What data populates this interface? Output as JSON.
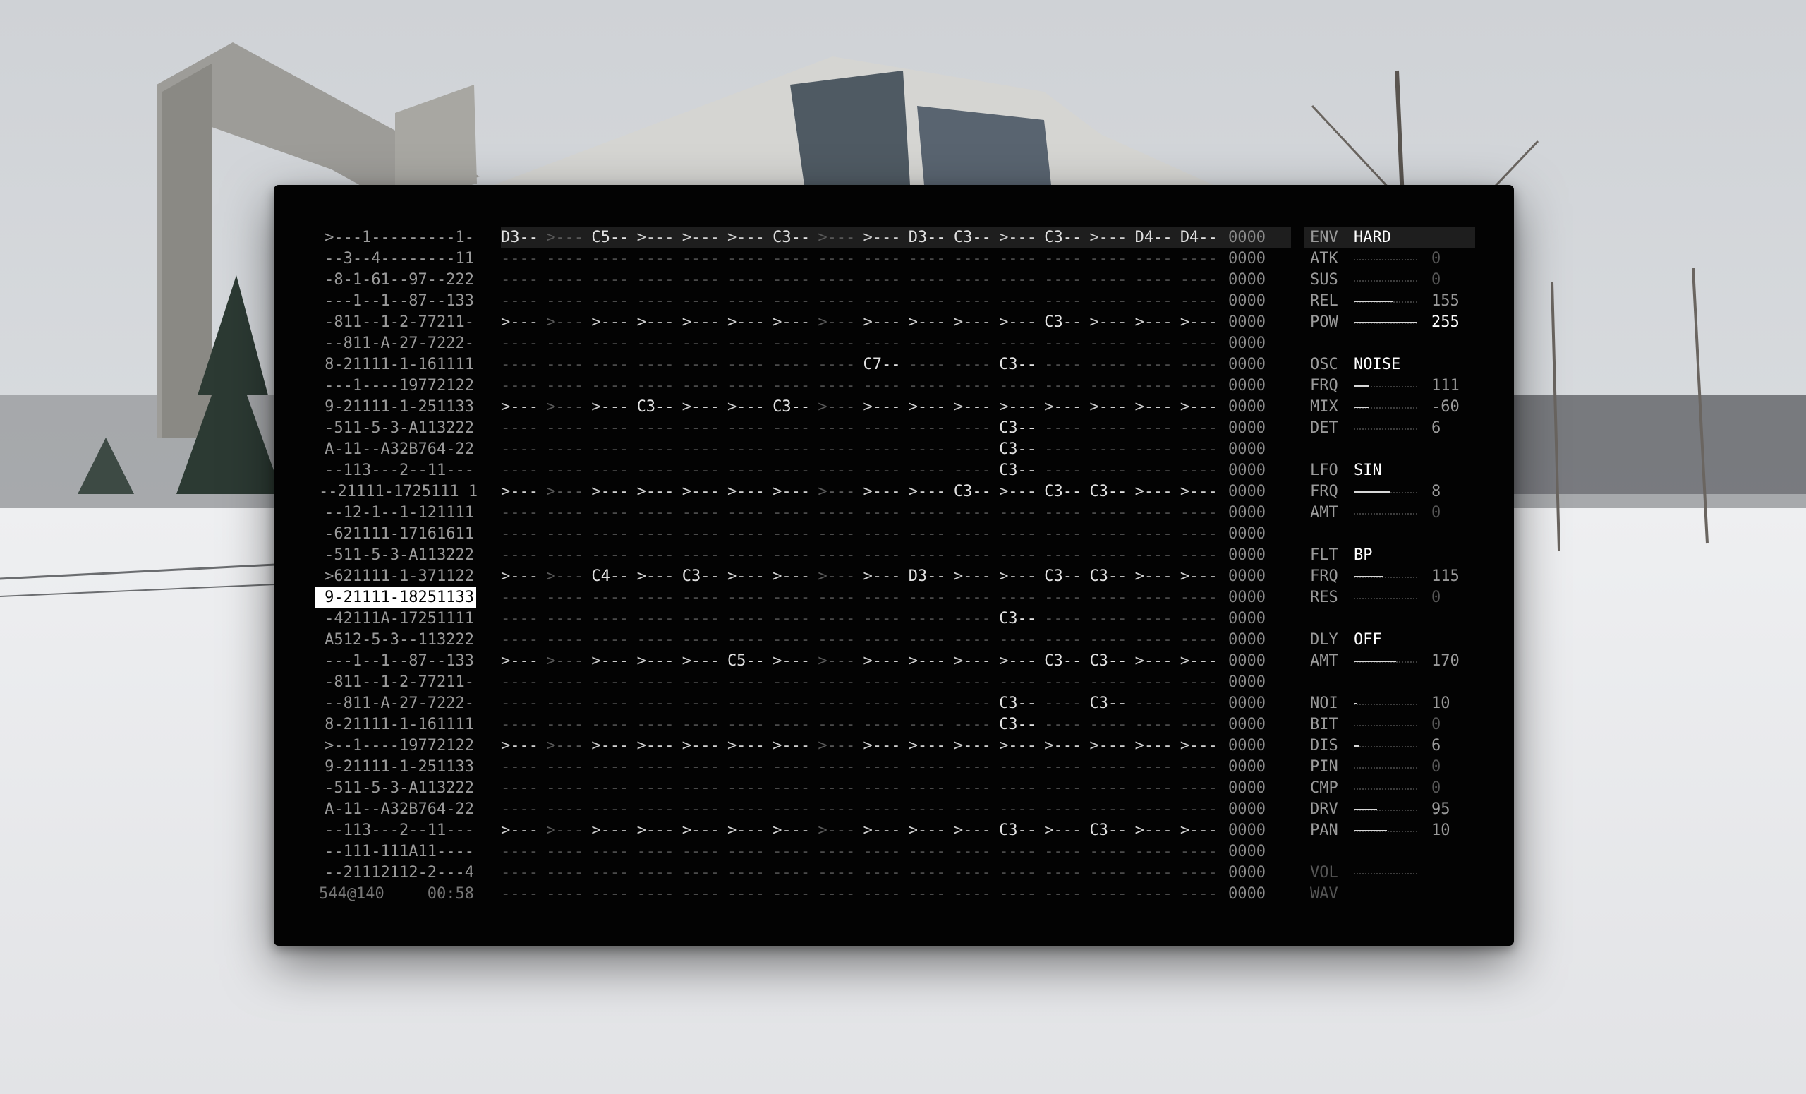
{
  "sequence": {
    "rows": [
      ">---1---------1-",
      "--3--4--------11",
      "-8-1-61--97--222",
      "---1--1--87--133",
      "-811--1-2-77211-",
      "--811-A-27-7222-",
      "8-21111-1-161111",
      "---1----19772122",
      "9-21111-1-251133",
      "-511-5-3-A113222",
      "A-11--A32B764-22",
      "--113---2--11---",
      "--21111-1725111 1",
      "--12-1--1-121111",
      "-621111-17161611",
      "-511-5-3-A113222",
      ">621111-1-371122",
      "9-21111-18251133",
      "-42111A-17251111",
      "A512-5-3--113222",
      "---1--1--87--133",
      "-811--1-2-77211-",
      "--811-A-27-7222-",
      "8-21111-1-161111",
      ">--1----19772122",
      "9-21111-1-251133",
      "-511-5-3-A113222",
      "A-11--A32B764-22",
      "--113---2--11---",
      "--111-111A11----",
      "--21112112-2---4"
    ],
    "selected_index": 17,
    "footer_left": "544@140",
    "footer_right": "00:58"
  },
  "grid": {
    "empty": "----",
    "hex_values": [
      "0000",
      "0000",
      "0000",
      "0000",
      "0000",
      "0000",
      "0000",
      "0000",
      "0000",
      "0000",
      "0000",
      "0000",
      "0000",
      "0000",
      "0000",
      "0000",
      "0000",
      "0000",
      "0000",
      "0000",
      "0000",
      "0000",
      "0000",
      "0000",
      "0000",
      "0000",
      "0000",
      "0000",
      "0000",
      "0000",
      "0000",
      "0000"
    ],
    "rows": [
      [
        "D3--",
        ">---",
        "C5--",
        ">---",
        ">---",
        ">---",
        "C3--",
        ">---",
        ">---",
        "D3--",
        "C3--",
        ">---",
        "C3--",
        ">---",
        "D4--",
        "D4--"
      ],
      [],
      [],
      [],
      [
        ">---",
        ">---",
        ">---",
        ">---",
        ">---",
        ">---",
        ">---",
        ">---",
        ">---",
        ">---",
        ">---",
        ">---",
        "C3--",
        ">---",
        ">---",
        ">---"
      ],
      [],
      [
        "",
        "",
        "",
        "",
        "",
        "",
        "",
        "",
        "C7--",
        "",
        "",
        "C3--",
        "",
        "",
        "",
        ""
      ],
      [],
      [
        ">---",
        ">---",
        ">---",
        "C3--",
        ">---",
        ">---",
        "C3--",
        ">---",
        ">---",
        ">---",
        ">---",
        ">---",
        ">---",
        ">---",
        ">---",
        ">---"
      ],
      [
        "",
        "",
        "",
        "",
        "",
        "",
        "",
        "",
        "",
        "",
        "",
        "C3--",
        "",
        "",
        "",
        ""
      ],
      [
        "",
        "",
        "",
        "",
        "",
        "",
        "",
        "",
        "",
        "",
        "",
        "C3--",
        "",
        "",
        "",
        ""
      ],
      [
        "",
        "",
        "",
        "",
        "",
        "",
        "",
        "",
        "",
        "",
        "",
        "C3--",
        "",
        "",
        "",
        ""
      ],
      [
        ">---",
        ">---",
        ">---",
        ">---",
        ">---",
        ">---",
        ">---",
        ">---",
        ">---",
        ">---",
        "C3--",
        ">---",
        "C3--",
        "C3--",
        ">---",
        ">---"
      ],
      [],
      [],
      [],
      [
        ">---",
        ">---",
        "C4--",
        ">---",
        "C3--",
        ">---",
        ">---",
        ">---",
        ">---",
        "D3--",
        ">---",
        ">---",
        "C3--",
        "C3--",
        ">---",
        ">---"
      ],
      [],
      [
        "",
        "",
        "",
        "",
        "",
        "",
        "",
        "",
        "",
        "",
        "",
        "C3--",
        "",
        "",
        "",
        ""
      ],
      [],
      [
        ">---",
        ">---",
        ">---",
        ">---",
        ">---",
        "C5--",
        ">---",
        ">---",
        ">---",
        ">---",
        ">---",
        ">---",
        "C3--",
        "C3--",
        ">---",
        ">---"
      ],
      [],
      [
        "",
        "",
        "",
        "",
        "",
        "",
        "",
        "",
        "",
        "",
        "",
        "C3--",
        "",
        "C3--",
        "",
        ""
      ],
      [
        "",
        "",
        "",
        "",
        "",
        "",
        "",
        "",
        "",
        "",
        "",
        "C3--",
        "",
        "",
        "",
        ""
      ],
      [
        ">---",
        ">---",
        ">---",
        ">---",
        ">---",
        ">---",
        ">---",
        ">---",
        ">---",
        ">---",
        ">---",
        ">---",
        ">---",
        ">---",
        ">---",
        ">---"
      ],
      [],
      [],
      [],
      [
        ">---",
        ">---",
        ">---",
        ">---",
        ">---",
        ">---",
        ">---",
        ">---",
        ">---",
        ">---",
        ">---",
        "C3--",
        ">---",
        "C3--",
        ">---",
        ">---"
      ],
      [],
      [],
      []
    ],
    "dim_columns": [
      1,
      7
    ]
  },
  "params": {
    "groups": [
      {
        "label": "ENV",
        "value": "HARD",
        "highlight": true,
        "items": [
          {
            "label": "ATK",
            "value": "0",
            "level": 0
          },
          {
            "label": "SUS",
            "value": "0",
            "level": 0
          },
          {
            "label": "REL",
            "value": "155",
            "level": 0.61
          },
          {
            "label": "POW",
            "value": "255",
            "level": 1.0,
            "bright": true
          }
        ]
      },
      {
        "label": "OSC",
        "value": "NOISE",
        "items": [
          {
            "label": "FRQ",
            "value": "111",
            "level": 0.24
          },
          {
            "label": "MIX",
            "value": "-60",
            "level": 0.24
          },
          {
            "label": "DET",
            "value": "6",
            "level": 0
          }
        ]
      },
      {
        "label": "LFO",
        "value": "SIN",
        "items": [
          {
            "label": "FRQ",
            "value": "8",
            "level": 0.58
          },
          {
            "label": "AMT",
            "value": "0",
            "level": 0
          }
        ]
      },
      {
        "label": "FLT",
        "value": "BP",
        "items": [
          {
            "label": "FRQ",
            "value": "115",
            "level": 0.45
          },
          {
            "label": "RES",
            "value": "0",
            "level": 0
          }
        ]
      },
      {
        "label": "DLY",
        "value": "OFF",
        "items": [
          {
            "label": "AMT",
            "value": "170",
            "level": 0.67
          }
        ]
      },
      {
        "label": "",
        "value": "",
        "items": [
          {
            "label": "NOI",
            "value": "10",
            "level": 0.04
          },
          {
            "label": "BIT",
            "value": "0",
            "level": 0
          },
          {
            "label": "DIS",
            "value": "6",
            "level": 0.08
          },
          {
            "label": "PIN",
            "value": "0",
            "level": 0
          },
          {
            "label": "CMP",
            "value": "0",
            "level": 0
          },
          {
            "label": "DRV",
            "value": "95",
            "level": 0.37
          },
          {
            "label": "PAN",
            "value": "10",
            "level": 0.52
          }
        ]
      },
      {
        "label": "",
        "value": "",
        "items": [
          {
            "label": "VOL",
            "value": "",
            "level": 0,
            "dim": true
          },
          {
            "label": "WAV",
            "value": "",
            "level": null,
            "dim": true
          }
        ]
      }
    ]
  }
}
